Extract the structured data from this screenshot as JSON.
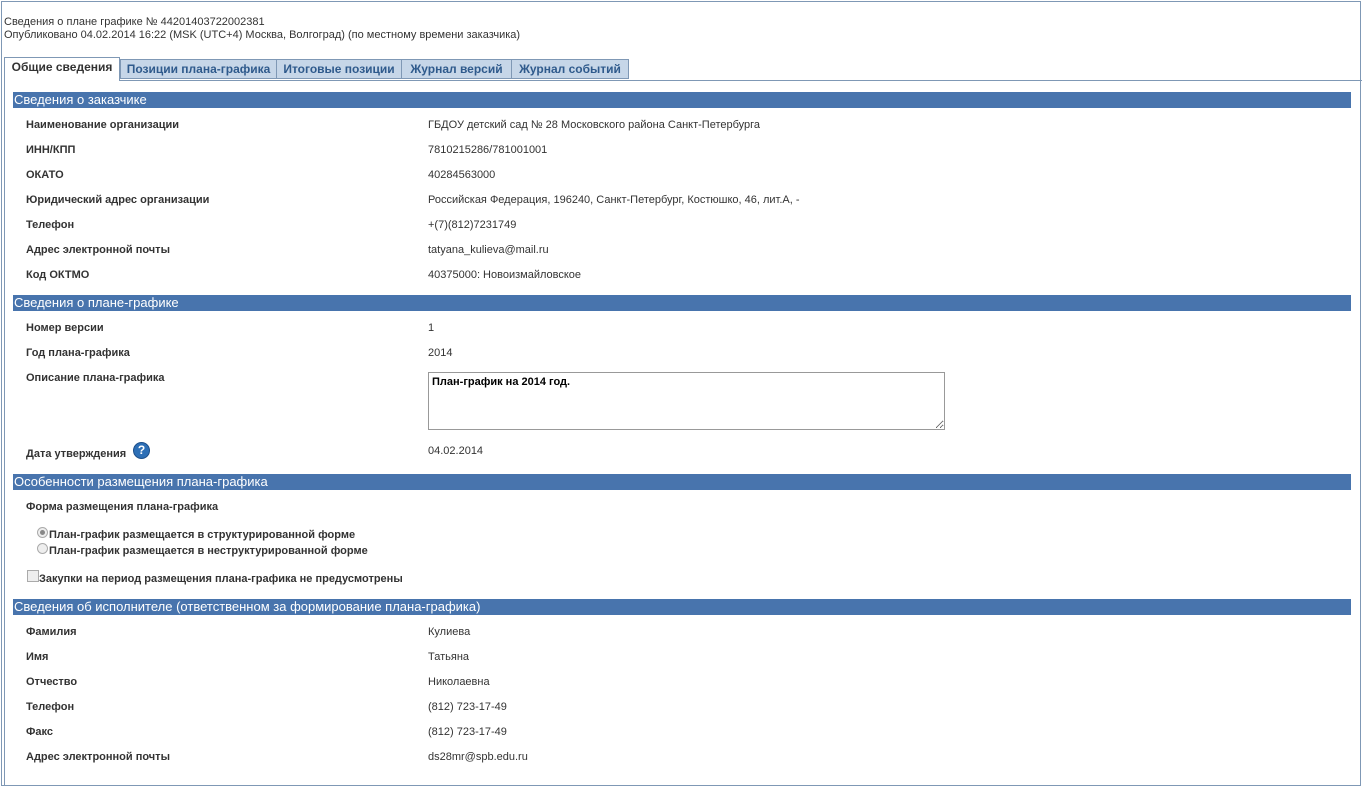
{
  "header": {
    "title": "Сведения о плане графике № 44201403722002381",
    "published": "Опубликовано 04.02.2014 16:22 (MSK (UTC+4) Москва, Волгоград) (по местному времени заказчика)"
  },
  "tabs": [
    {
      "label": "Общие сведения",
      "active": true
    },
    {
      "label": "Позиции плана-графика"
    },
    {
      "label": "Итоговые позиции"
    },
    {
      "label": "Журнал версий"
    },
    {
      "label": "Журнал событий"
    }
  ],
  "customer": {
    "title": "Сведения о заказчике",
    "rows": [
      {
        "label": "Наименование организации",
        "value": "ГБДОУ детский сад № 28 Московского района Санкт-Петербурга"
      },
      {
        "label": "ИНН/КПП",
        "value": "7810215286/781001001"
      },
      {
        "label": "ОКАТО",
        "value": "40284563000"
      },
      {
        "label": "Юридический адрес организации",
        "value": "Российская Федерация, 196240, Санкт-Петербург, Костюшко, 46, лит.А, -"
      },
      {
        "label": "Телефон",
        "value": "+(7)(812)7231749"
      },
      {
        "label": "Адрес электронной почты",
        "value": "tatyana_kulieva@mail.ru"
      },
      {
        "label": "Код ОКТМО",
        "value": "40375000: Новоизмайловское"
      }
    ]
  },
  "plan": {
    "title": "Сведения о плане-графике",
    "version_label": "Номер версии",
    "version_value": "1",
    "year_label": "Год плана-графика",
    "year_value": "2014",
    "description_label": "Описание плана-графика",
    "description_value": "План-график на 2014 год.",
    "approval_label": "Дата утверждения",
    "approval_value": "04.02.2014",
    "help_glyph": "?"
  },
  "placement": {
    "title": "Особенности размещения плана-графика",
    "form_label": "Форма размещения плана-графика",
    "option_structured": "План-график размещается в структурированной форме",
    "option_unstructured": "План-график размещается в неструктурированной форме",
    "selected": "structured",
    "no_purchases_label": "Закупки на период размещения плана-графика не предусмотрены",
    "no_purchases_checked": false
  },
  "executor": {
    "title": "Сведения об исполнителе (ответственном за формирование плана-графика)",
    "rows": [
      {
        "label": "Фамилия",
        "value": "Кулиева"
      },
      {
        "label": "Имя",
        "value": "Татьяна"
      },
      {
        "label": "Отчество",
        "value": "Николаевна"
      },
      {
        "label": "Телефон",
        "value": "(812) 723-17-49"
      },
      {
        "label": "Факс",
        "value": "(812) 723-17-49"
      },
      {
        "label": "Адрес электронной почты",
        "value": "ds28mr@spb.edu.ru"
      }
    ]
  },
  "colors": {
    "section_header_bg": "#4874ad",
    "tab_bg": "#c6d6e8",
    "tab_text": "#2f5a8c",
    "border": "#7f98b5",
    "help_icon_bg": "#2d6fb6"
  }
}
